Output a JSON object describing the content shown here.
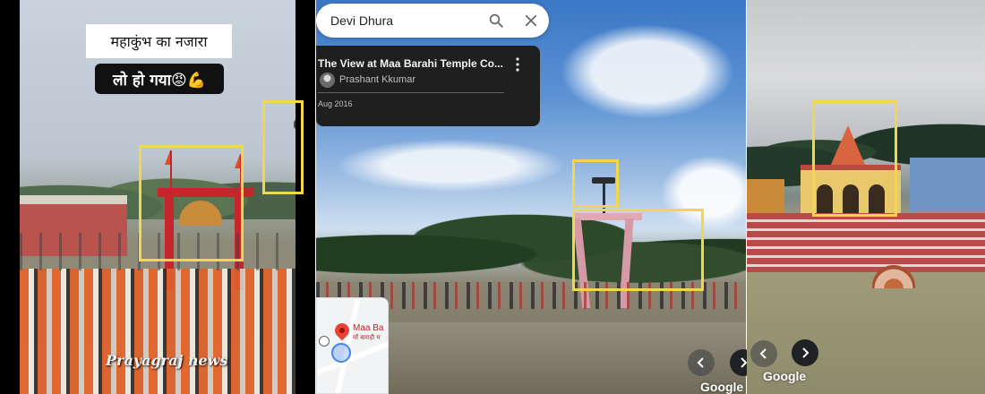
{
  "panels": {
    "video": {
      "caption_line1": "महाकुंभ का नजारा",
      "caption_line2": "लो हो गया😡💪",
      "watermark": "Prayagraj news"
    },
    "street_view": {
      "search": {
        "value": "Devi Dhura"
      },
      "info_card": {
        "title": "The View at Maa Barahi Temple Co...",
        "author": "Prashant Kkumar",
        "date": "Aug 2016"
      },
      "minimap": {
        "label": "Maa Ba",
        "sublabel": "माँ बाराही म"
      },
      "google_logo": "Google"
    },
    "temple_view": {
      "google_logo": "Google"
    }
  },
  "colors": {
    "highlight": "#f2d64b",
    "card_bg": "#1f1f1f",
    "pin": "#ea4335"
  },
  "icons": [
    "search-icon",
    "close-icon",
    "kebab-icon",
    "chevron-left-icon",
    "chevron-right-icon",
    "map-pin-icon"
  ]
}
